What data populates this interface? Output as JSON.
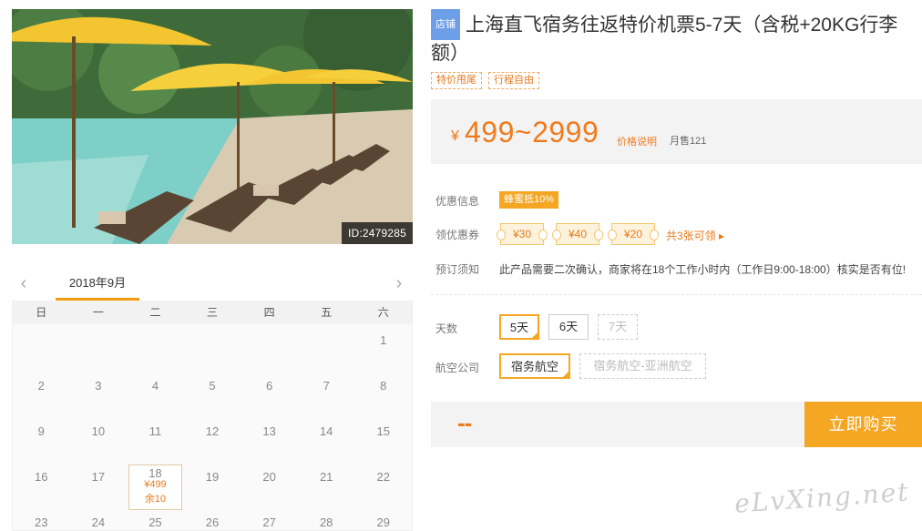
{
  "photo": {
    "id_label": "ID:2479285"
  },
  "product": {
    "shop_badge": "店铺",
    "title": "上海直飞宿务往返特价机票5-7天（含税+20KG行李额）",
    "tags": [
      "特价甩尾",
      "行程自由"
    ],
    "price_yen": "¥",
    "price_range": "499~2999",
    "price_explain": "价格说明",
    "monthly_sales": "月售121"
  },
  "offers": {
    "label": "优惠信息",
    "badge": "蜂蜜抵10%",
    "coupon_label": "领优惠券",
    "coupons": [
      "¥30",
      "¥40",
      "¥20"
    ],
    "coupon_total": "共3张可领 ▸"
  },
  "notice": {
    "label": "预订须知",
    "text": "此产品需要二次确认，商家将在18个工作小时内（工作日9:00-18:00）核实是否有位!"
  },
  "options": {
    "days_label": "天数",
    "days": [
      "5天",
      "6天",
      "7天"
    ],
    "airline_label": "航空公司",
    "airlines": [
      "宿务航空",
      "宿务航空-亚洲航空"
    ]
  },
  "buy": {
    "total": "--",
    "button": "立即购买"
  },
  "calendar": {
    "month": "2018年9月",
    "prev": "‹",
    "next": "›",
    "weekdays": [
      "日",
      "一",
      "二",
      "三",
      "四",
      "五",
      "六"
    ],
    "weeks": [
      [
        "",
        "",
        "",
        "",
        "",
        "",
        "1"
      ],
      [
        "2",
        "3",
        "4",
        "5",
        "6",
        "7",
        "8"
      ],
      [
        "9",
        "10",
        "11",
        "12",
        "13",
        "14",
        "15"
      ],
      [
        "16",
        "17",
        "18",
        "19",
        "20",
        "21",
        "22"
      ],
      [
        "23",
        "24",
        "25",
        "26",
        "27",
        "28",
        "29"
      ]
    ],
    "available_day": {
      "day": "18",
      "price": "¥499",
      "stock": "余10"
    }
  },
  "watermark": "eLvXing.net",
  "colors": {
    "accent": "#f5a623",
    "price": "#f07b1c",
    "shop_badge": "#6d9ee8"
  }
}
